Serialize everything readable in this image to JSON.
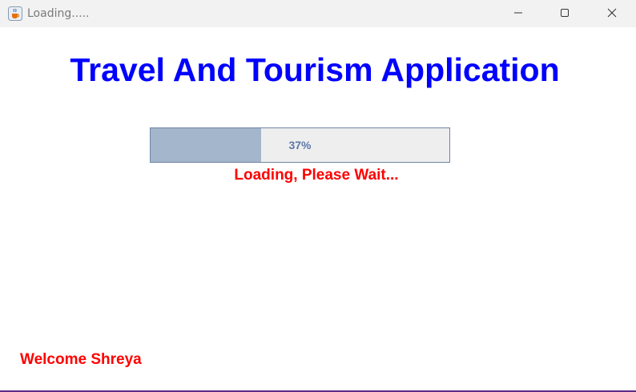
{
  "window": {
    "title": "Loading.....",
    "icon": "java-cup-icon",
    "controls": [
      "minimize-icon",
      "maximize-icon",
      "close-icon"
    ]
  },
  "main": {
    "heading": "Travel And Tourism Application",
    "progress": {
      "value": 37,
      "label": "37%"
    },
    "loading_message": "Loading, Please Wait...",
    "welcome_message": "Welcome Shreya"
  },
  "colors": {
    "heading": "#0000ff",
    "messages": "#ff0000",
    "progress_fill": "#a4b6cb",
    "progress_track": "#eeeeee",
    "progress_text": "#5d78a8"
  }
}
